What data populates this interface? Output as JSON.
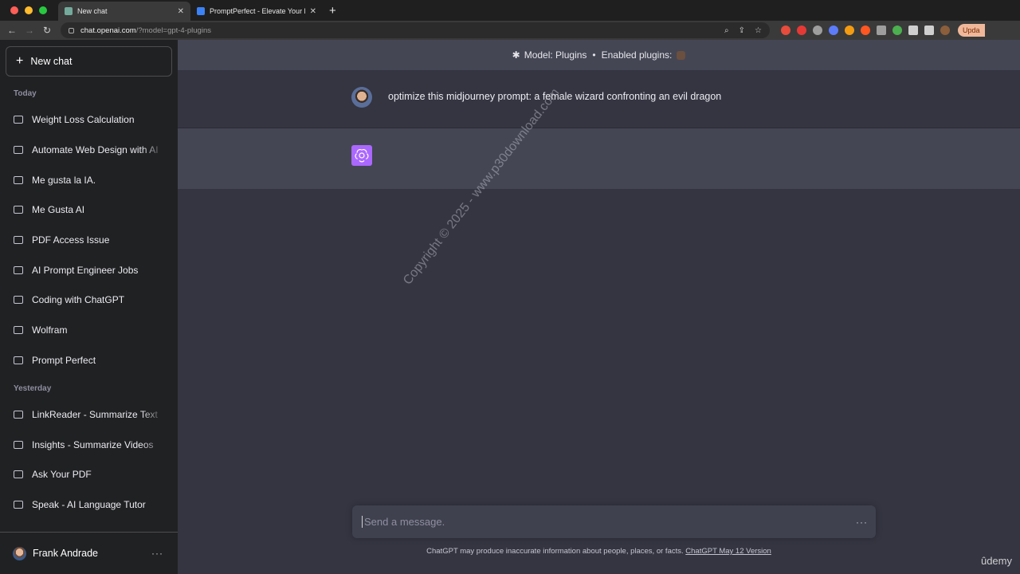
{
  "browser": {
    "tabs": [
      {
        "title": "New chat",
        "active": true,
        "favicon_color": "#74aa9c"
      },
      {
        "title": "PromptPerfect - Elevate Your P",
        "active": false,
        "favicon_color": "#3b82f6"
      }
    ],
    "new_tab_symbol": "+",
    "url_host": "chat.openai.com",
    "url_path": "/?model=gpt-4-plugins",
    "update_label": "Upda",
    "traffic_colors": [
      "#ff5f57",
      "#febc2e",
      "#28c840"
    ],
    "extension_colors": [
      "#e74c3c",
      "#e53935",
      "#9e9e9e",
      "#5c7cfa",
      "#f39c12",
      "#ff5722",
      "#9e9e9e",
      "#4caf50",
      "#cfcfcf",
      "#8b5e3c"
    ]
  },
  "sidebar": {
    "new_chat_label": "New chat",
    "sections": [
      {
        "title": "Today",
        "items": [
          "Weight Loss Calculation",
          "Automate Web Design with AI",
          "Me gusta la IA.",
          "Me Gusta AI",
          "PDF Access Issue",
          "AI Prompt Engineer Jobs",
          "Coding with ChatGPT",
          "Wolfram",
          "Prompt Perfect"
        ]
      },
      {
        "title": "Yesterday",
        "items": [
          "LinkReader - Summarize Text",
          "Insights - Summarize Videos",
          "Ask Your PDF",
          "Speak - AI Language Tutor"
        ]
      }
    ],
    "user_name": "Frank Andrade",
    "user_menu": "···"
  },
  "main": {
    "model_label": "Model: Plugins",
    "separator": "•",
    "plugins_label": "Enabled plugins:",
    "user_message": "optimize this midjourney prompt: a female wizard confronting an evil dragon",
    "watermark": "Copyright © 2025 - www.p30download.com",
    "composer_placeholder": "Send a message.",
    "composer_menu": "···",
    "disclaimer_text": "ChatGPT may produce inaccurate information about people, places, or facts.",
    "disclaimer_link": "ChatGPT May 12 Version",
    "brand_watermark": "ûdemy",
    "accent_color": "#ab68ff"
  }
}
